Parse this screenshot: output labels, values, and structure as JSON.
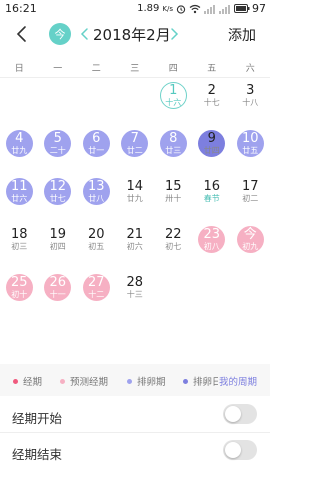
{
  "status_bar": {
    "time": "16:21",
    "net_speed": "1.89",
    "net_unit": "K/s",
    "battery": "97"
  },
  "header": {
    "today_label": "今",
    "month_title": "2018年2月",
    "add_label": "添加"
  },
  "weekdays": [
    "日",
    "一",
    "二",
    "三",
    "四",
    "五",
    "六"
  ],
  "weeks": [
    [
      null,
      null,
      null,
      null,
      {
        "day": "1",
        "lunar": "十六",
        "state": "today"
      },
      {
        "day": "2",
        "lunar": "十七",
        "state": ""
      },
      {
        "day": "3",
        "lunar": "十八",
        "state": ""
      }
    ],
    [
      {
        "day": "4",
        "lunar": "廿九",
        "state": "ov"
      },
      {
        "day": "5",
        "lunar": "二十",
        "state": "ov"
      },
      {
        "day": "6",
        "lunar": "廿一",
        "state": "ov"
      },
      {
        "day": "7",
        "lunar": "廿二",
        "state": "ov"
      },
      {
        "day": "8",
        "lunar": "廿三",
        "state": "ov"
      },
      {
        "day": "9",
        "lunar": "廿四",
        "state": "ovpeak"
      },
      {
        "day": "10",
        "lunar": "廿五",
        "state": "ov"
      }
    ],
    [
      {
        "day": "11",
        "lunar": "廿六",
        "state": "ov"
      },
      {
        "day": "12",
        "lunar": "廿七",
        "state": "ov"
      },
      {
        "day": "13",
        "lunar": "廿八",
        "state": "ov"
      },
      {
        "day": "14",
        "lunar": "廿九",
        "state": ""
      },
      {
        "day": "15",
        "lunar": "卅十",
        "state": ""
      },
      {
        "day": "16",
        "lunar": "春节",
        "state": "festival"
      },
      {
        "day": "17",
        "lunar": "初二",
        "state": ""
      }
    ],
    [
      {
        "day": "18",
        "lunar": "初三",
        "state": ""
      },
      {
        "day": "19",
        "lunar": "初四",
        "state": ""
      },
      {
        "day": "20",
        "lunar": "初五",
        "state": ""
      },
      {
        "day": "21",
        "lunar": "初六",
        "state": ""
      },
      {
        "day": "22",
        "lunar": "初七",
        "state": ""
      },
      {
        "day": "23",
        "lunar": "初八",
        "state": "pred"
      },
      {
        "day": "今",
        "lunar": "初九",
        "state": "pred"
      }
    ],
    [
      {
        "day": "25",
        "lunar": "初十",
        "state": "pred"
      },
      {
        "day": "26",
        "lunar": "十一",
        "state": "pred"
      },
      {
        "day": "27",
        "lunar": "十二",
        "state": "pred"
      },
      {
        "day": "28",
        "lunar": "十三",
        "state": ""
      },
      null,
      null,
      null
    ]
  ],
  "legend": {
    "items": [
      {
        "label": "经期",
        "color": "#f05a7e"
      },
      {
        "label": "预测经期",
        "color": "#f6b0c3"
      },
      {
        "label": "排卵期",
        "color": "#9fa2ee"
      },
      {
        "label": "排卵日",
        "color": "#7d7fdf"
      }
    ],
    "my_cycle": "我的周期"
  },
  "settings": {
    "period_start": {
      "label": "经期开始",
      "enabled": false
    },
    "period_end": {
      "label": "经期结束",
      "enabled": false
    }
  },
  "colors": {
    "accent": "#65d1c8",
    "ovulation": "#9fa2ee",
    "ovulation_day": "#7d7fdf",
    "predicted": "#f6b0c3",
    "period": "#f05a7e"
  }
}
